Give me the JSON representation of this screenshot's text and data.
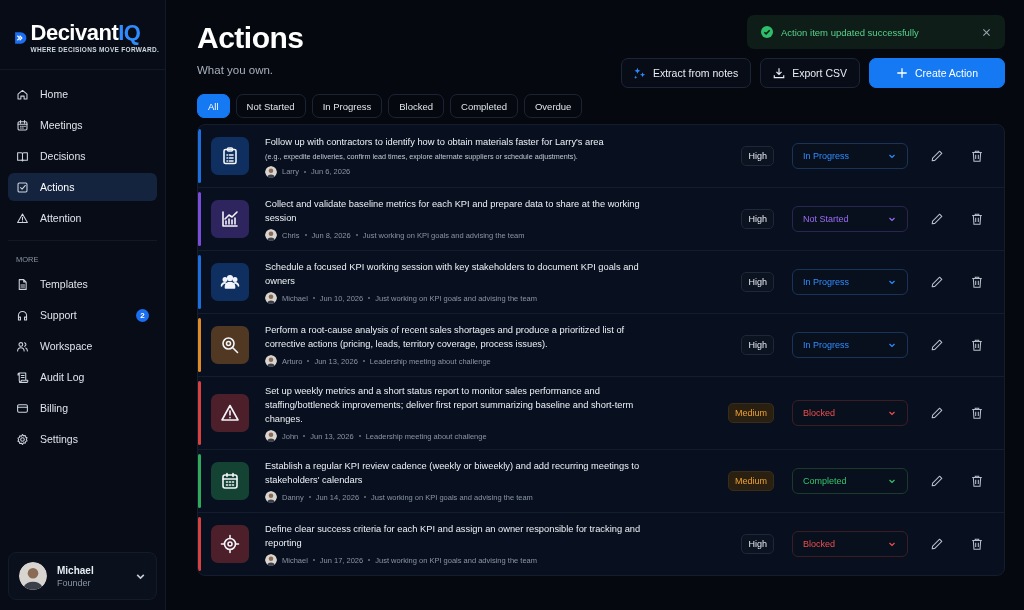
{
  "logo": {
    "name": "Decivant",
    "suffix": "IQ",
    "tagline": "WHERE DECISIONS MOVE FORWARD."
  },
  "sidebar": {
    "items": [
      {
        "label": "Home",
        "kind": "home",
        "selected": false
      },
      {
        "label": "Meetings",
        "kind": "calendar",
        "selected": false
      },
      {
        "label": "Decisions",
        "kind": "book",
        "selected": false
      },
      {
        "label": "Actions",
        "kind": "checkbox",
        "selected": true
      },
      {
        "label": "Attention",
        "kind": "warning",
        "selected": false
      }
    ],
    "section_label": "MORE",
    "more_items": [
      {
        "label": "Templates",
        "kind": "document",
        "selected": false
      },
      {
        "label": "Support",
        "kind": "headset",
        "selected": false,
        "badge": "2"
      },
      {
        "label": "Workspace",
        "kind": "people",
        "selected": false
      },
      {
        "label": "Audit Log",
        "kind": "scroll",
        "selected": false
      },
      {
        "label": "Billing",
        "kind": "card",
        "selected": false
      },
      {
        "label": "Settings",
        "kind": "gear",
        "selected": false
      }
    ],
    "user": {
      "name": "Michael",
      "role": "Founder"
    }
  },
  "page": {
    "title": "Actions",
    "subtitle": "What you own."
  },
  "toast": {
    "message": "Action item updated successfully"
  },
  "buttons": [
    {
      "label": "Extract from notes",
      "kind": "extract"
    },
    {
      "label": "Export CSV",
      "kind": "export"
    },
    {
      "label": "Create Action",
      "kind": "create"
    }
  ],
  "filters": [
    {
      "label": "All",
      "selected": true
    },
    {
      "label": "Not Started",
      "selected": false
    },
    {
      "label": "In Progress",
      "selected": false
    },
    {
      "label": "Blocked",
      "selected": false
    },
    {
      "label": "Completed",
      "selected": false
    },
    {
      "label": "Overdue",
      "selected": false
    }
  ],
  "actions": [
    {
      "title": "Follow up with contractors to identify how to obtain materials faster for Larry's area",
      "detail": "(e.g., expedite deliveries, confirm lead times, explore alternate suppliers or schedule adjustments).",
      "owner": "Larry",
      "date": "Jun 6, 2026",
      "kind": "clipboard",
      "color": "#1d6fe0",
      "priority": {
        "label": "High",
        "kind": "high"
      },
      "status": {
        "label": "In Progress",
        "kind": "in_progress"
      }
    },
    {
      "title": "Collect and validate baseline metrics for each KPI and prepare data to share at the working session",
      "owner": "Chris",
      "date": "Jun 8, 2026",
      "note": "Just working on KPI goals and advising the team",
      "kind": "chart",
      "color": "#7c4ddb",
      "priority": {
        "label": "High",
        "kind": "high"
      },
      "status": {
        "label": "Not Started",
        "kind": "not_started"
      }
    },
    {
      "title": "Schedule a focused KPI working session with key stakeholders to document KPI goals and owners",
      "owner": "Michael",
      "date": "Jun 10, 2026",
      "note": "Just working on KPI goals and advising the team",
      "kind": "people",
      "color": "#1d6fe0",
      "priority": {
        "label": "High",
        "kind": "high"
      },
      "status": {
        "label": "In Progress",
        "kind": "in_progress"
      }
    },
    {
      "title": "Perform a root-cause analysis of recent sales shortages and produce a prioritized list of corrective actions (pricing, leads, territory coverage, process issues).",
      "owner": "Arturo",
      "date": "Jun 13, 2026",
      "note": "Leadership meeting about challenge",
      "kind": "search",
      "color": "#e08a2a",
      "priority": {
        "label": "High",
        "kind": "high"
      },
      "status": {
        "label": "In Progress",
        "kind": "in_progress"
      }
    },
    {
      "title": "Set up weekly metrics and a short status report to monitor sales performance and staffing/bottleneck improvements; deliver first report summarizing baseline and short-term changes.",
      "owner": "John",
      "date": "Jun 13, 2026",
      "note": "Leadership meeting about challenge",
      "kind": "warning",
      "color": "#d94040",
      "priority": {
        "label": "Medium",
        "kind": "medium"
      },
      "status": {
        "label": "Blocked",
        "kind": "blocked"
      }
    },
    {
      "title": "Establish a regular KPI review cadence (weekly or biweekly) and add recurring meetings to stakeholders' calendars",
      "owner": "Danny",
      "date": "Jun 14, 2026",
      "note": "Just working on KPI goals and advising the team",
      "kind": "calendar",
      "color": "#2eaa5a",
      "priority": {
        "label": "Medium",
        "kind": "medium"
      },
      "status": {
        "label": "Completed",
        "kind": "completed"
      }
    },
    {
      "title": "Define clear success criteria for each KPI and assign an owner responsible for tracking and reporting",
      "owner": "Michael",
      "date": "Jun 17, 2026",
      "note": "Just working on KPI goals and advising the team",
      "kind": "target",
      "color": "#d94040",
      "priority": {
        "label": "High",
        "kind": "high"
      },
      "status": {
        "label": "Blocked",
        "kind": "blocked"
      }
    }
  ]
}
